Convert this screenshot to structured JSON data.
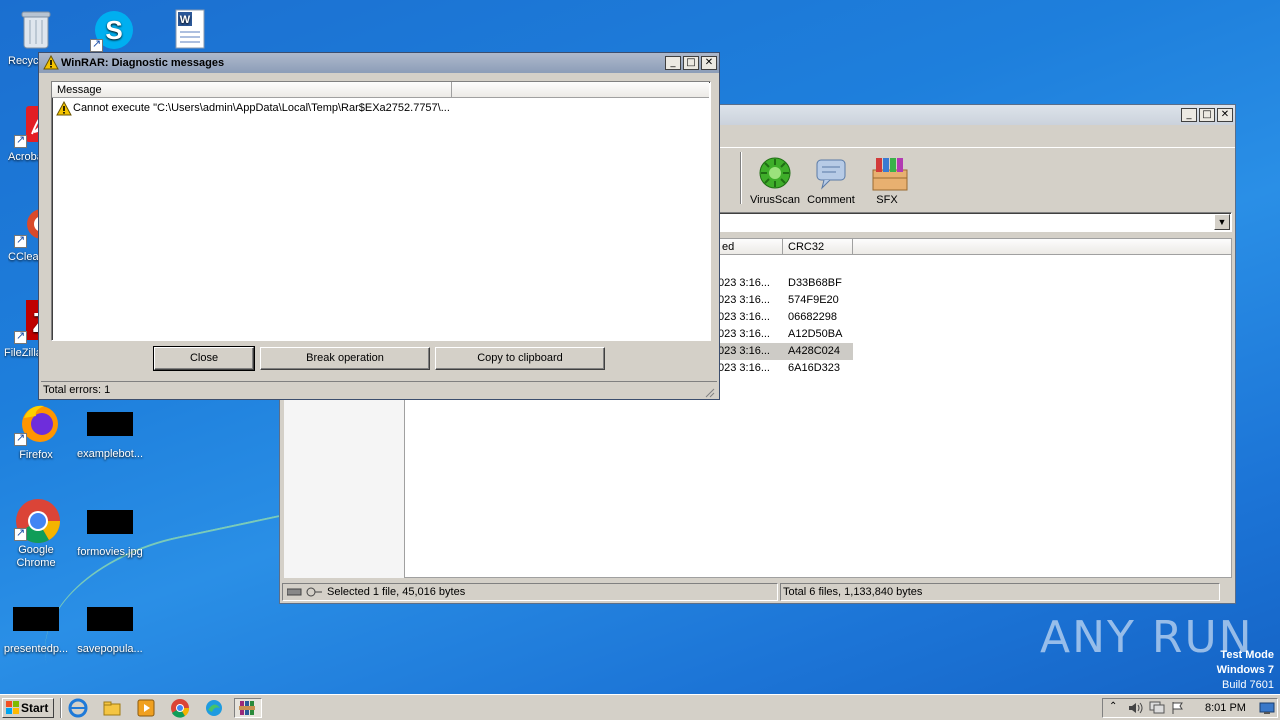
{
  "desktop": {
    "icons": [
      {
        "label": "Recycle Bin"
      },
      {
        "label": "Skype"
      },
      {
        "label": ""
      },
      {
        "label": "Acrobat Reader DC"
      },
      {
        "label": "CCleaner"
      },
      {
        "label": "FileZilla Client"
      },
      {
        "label": "Firefox"
      },
      {
        "label": "examplebot..."
      },
      {
        "label": "Google Chrome"
      },
      {
        "label": "formovies.jpg"
      },
      {
        "label": "presentedp..."
      },
      {
        "label": "savepopula..."
      }
    ],
    "watermark": "ANY RUN",
    "test_mode": {
      "line1": "Test Mode",
      "line2": "Windows 7",
      "line3": "Build 7601"
    }
  },
  "winrar_main": {
    "toolbar": [
      {
        "label": "VirusScan",
        "icon": "virusscan-icon"
      },
      {
        "label": "Comment",
        "icon": "comment-icon"
      },
      {
        "label": "SFX",
        "icon": "sfx-icon"
      }
    ],
    "columns": [
      "ed",
      "CRC32"
    ],
    "rows": [
      {
        "modified": "023 3:16...",
        "crc": "D33B68BF",
        "selected": false
      },
      {
        "modified": "023 3:16...",
        "crc": "574F9E20",
        "selected": false
      },
      {
        "modified": "023 3:16...",
        "crc": "06682298",
        "selected": false
      },
      {
        "modified": "023 3:16...",
        "crc": "A12D50BA",
        "selected": false
      },
      {
        "modified": "023 3:16...",
        "crc": "A428C024",
        "selected": true
      },
      {
        "modified": "023 3:16...",
        "crc": "6A16D323",
        "selected": false
      }
    ],
    "status_left": "Selected 1 file, 45,016 bytes",
    "status_right": "Total 6 files, 1,133,840 bytes"
  },
  "diagnostic": {
    "title": "WinRAR: Diagnostic messages",
    "column_header": "Message",
    "messages": [
      "Cannot execute \"C:\\Users\\admin\\AppData\\Local\\Temp\\Rar$EXa2752.7757\\..."
    ],
    "buttons": {
      "close": "Close",
      "break": "Break operation",
      "copy": "Copy to clipboard"
    },
    "status": "Total errors: 1"
  },
  "taskbar": {
    "start_label": "Start",
    "clock": "8:01 PM"
  },
  "colors": {
    "selection": "#cdcbc6",
    "desktop": "#1e7fdc"
  }
}
